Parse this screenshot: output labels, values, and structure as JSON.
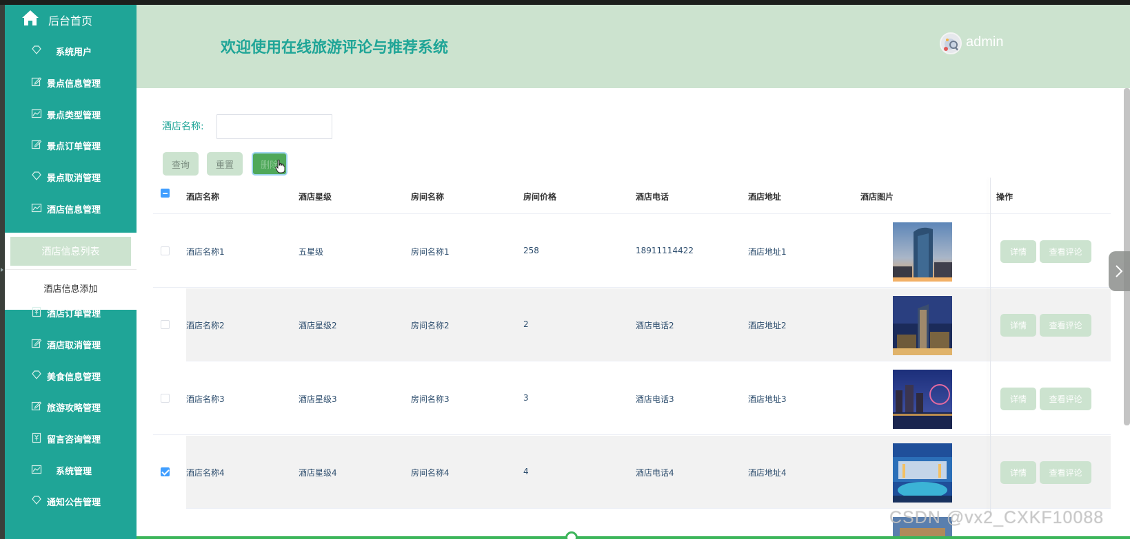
{
  "sidebar": {
    "home_label": "后台首页",
    "items": [
      {
        "label": "系统用户",
        "icon": "diamond-icon"
      },
      {
        "label": "景点信息管理",
        "icon": "edit-icon"
      },
      {
        "label": "景点类型管理",
        "icon": "chart-icon"
      },
      {
        "label": "景点订单管理",
        "icon": "edit-icon"
      },
      {
        "label": "景点取消管理",
        "icon": "diamond-icon"
      },
      {
        "label": "酒店信息管理",
        "icon": "chart-icon"
      },
      {
        "label": "酒店订单管理",
        "icon": "yen-icon"
      },
      {
        "label": "酒店取消管理",
        "icon": "edit-icon"
      },
      {
        "label": "美食信息管理",
        "icon": "diamond-icon"
      },
      {
        "label": "旅游攻略管理",
        "icon": "edit-icon"
      },
      {
        "label": "留言咨询管理",
        "icon": "yen-icon"
      },
      {
        "label": "系统管理",
        "icon": "chart-icon"
      },
      {
        "label": "通知公告管理",
        "icon": "diamond-icon"
      }
    ],
    "submenu": [
      {
        "label": "酒店信息列表",
        "active": true
      },
      {
        "label": "酒店信息添加",
        "active": false
      }
    ]
  },
  "header": {
    "title": "欢迎使用在线旅游评论与推荐系统",
    "username": "admin"
  },
  "search": {
    "label": "酒店名称:",
    "value": "",
    "query_label": "查询",
    "reset_label": "重置",
    "delete_label": "删除"
  },
  "table": {
    "columns": [
      "酒店名称",
      "酒店星级",
      "房间名称",
      "房间价格",
      "酒店电话",
      "酒店地址",
      "酒店图片",
      "操作"
    ],
    "rows": [
      {
        "name": "酒店名称1",
        "star": "五星级",
        "room": "房间名称1",
        "price": "258",
        "phone": "18911114422",
        "address": "酒店地址1",
        "checked": false
      },
      {
        "name": "酒店名称2",
        "star": "酒店星级2",
        "room": "房间名称2",
        "price": "2",
        "phone": "酒店电话2",
        "address": "酒店地址2",
        "checked": false
      },
      {
        "name": "酒店名称3",
        "star": "酒店星级3",
        "room": "房间名称3",
        "price": "3",
        "phone": "酒店电话3",
        "address": "酒店地址3",
        "checked": false
      },
      {
        "name": "酒店名称4",
        "star": "酒店星级4",
        "room": "房间名称4",
        "price": "4",
        "phone": "酒店电话4",
        "address": "酒店地址4",
        "checked": true
      }
    ],
    "detail_label": "详情",
    "comment_label": "查看评论"
  },
  "watermark": "CSDN @vx2_CXKF10088",
  "colors": {
    "sidebar": "#1fa597",
    "header": "#cce3cf",
    "accent": "#1fa597",
    "delete_button": "#4fa85a",
    "checkbox": "#409eff"
  }
}
